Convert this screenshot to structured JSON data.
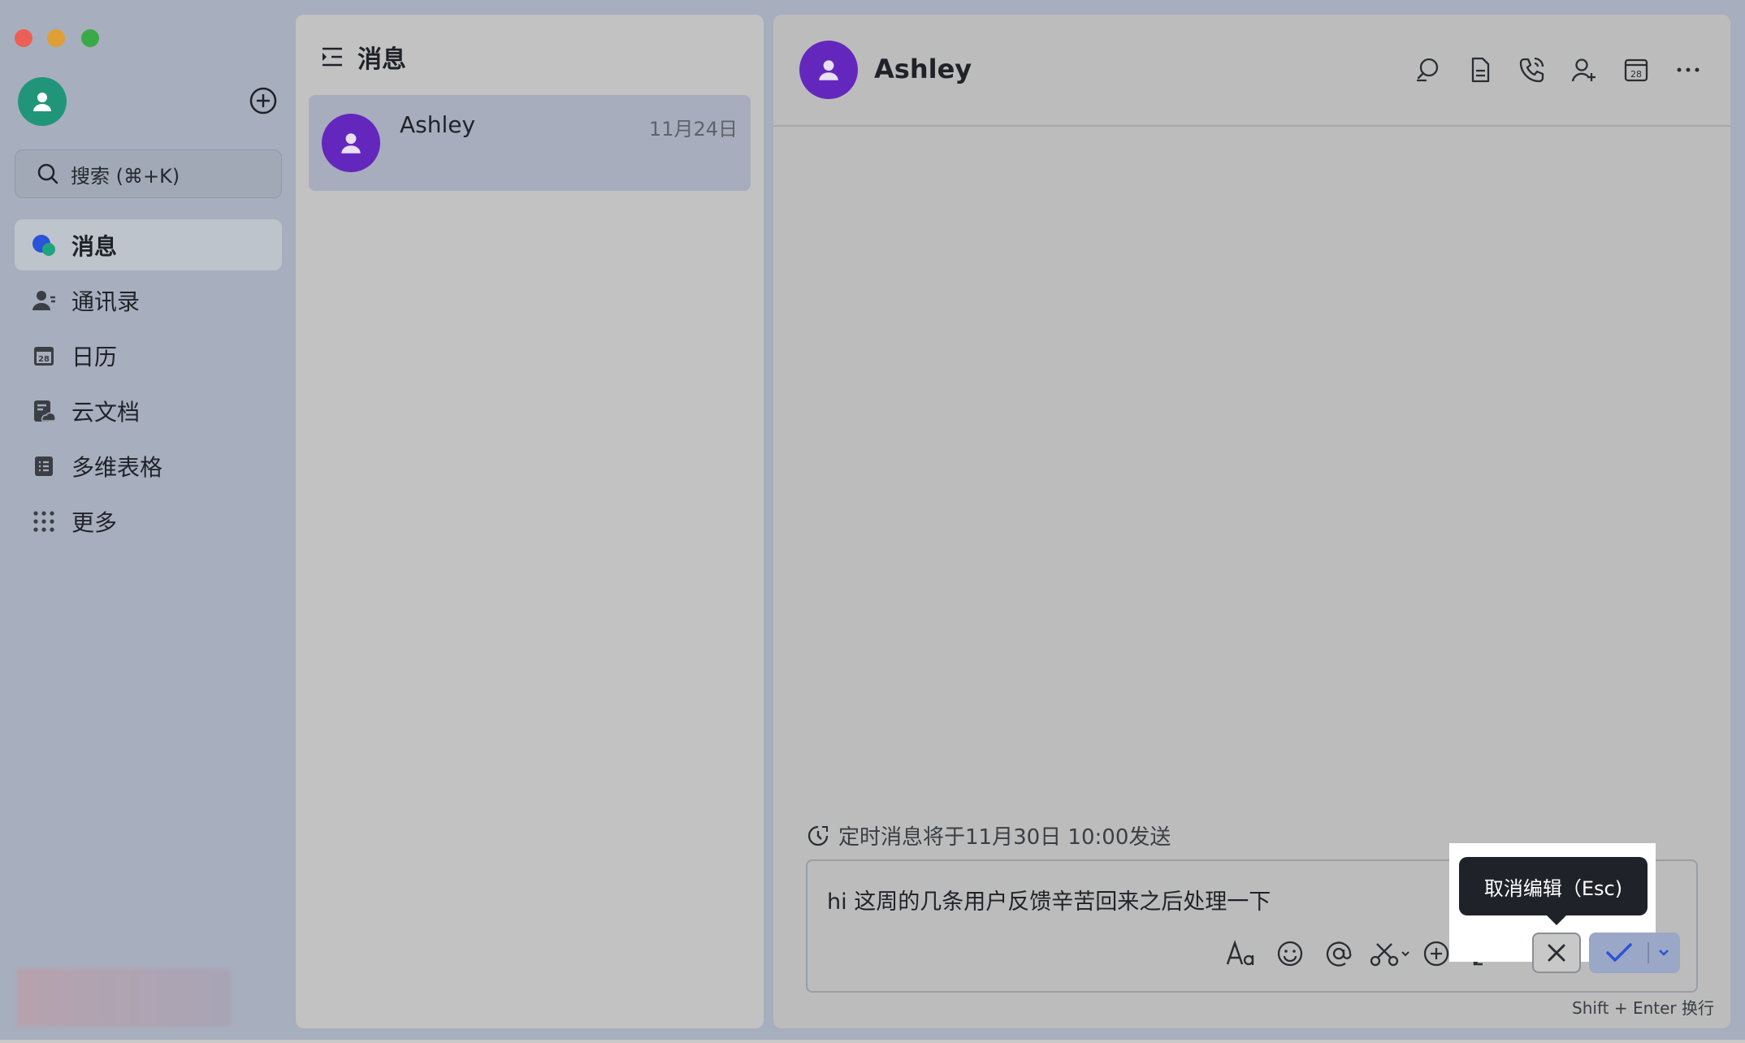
{
  "sidebar": {
    "search_placeholder": "搜索 (⌘+K)",
    "items": [
      {
        "label": "消息",
        "icon": "chat-bubbles-icon",
        "active": true
      },
      {
        "label": "通讯录",
        "icon": "contacts-icon",
        "active": false
      },
      {
        "label": "日历",
        "icon": "calendar-icon",
        "active": false
      },
      {
        "label": "云文档",
        "icon": "cloud-doc-icon",
        "active": false
      },
      {
        "label": "多维表格",
        "icon": "table-icon",
        "active": false
      },
      {
        "label": "更多",
        "icon": "grid-dots-icon",
        "active": false
      }
    ]
  },
  "list": {
    "title": "消息",
    "chats": [
      {
        "name": "Ashley",
        "date": "11月24日"
      }
    ]
  },
  "chat": {
    "name": "Ashley",
    "scheduled_note": "定时消息将于11月30日 10:00发送",
    "draft_text": "hi 这周的几条用户反馈辛苦回来之后处理一下",
    "tooltip": "取消编辑（Esc)",
    "hint": "Shift + Enter 换行"
  },
  "colors": {
    "accent": "#2b52d9",
    "avatar_purple": "#6427bd",
    "avatar_green": "#21957a"
  }
}
